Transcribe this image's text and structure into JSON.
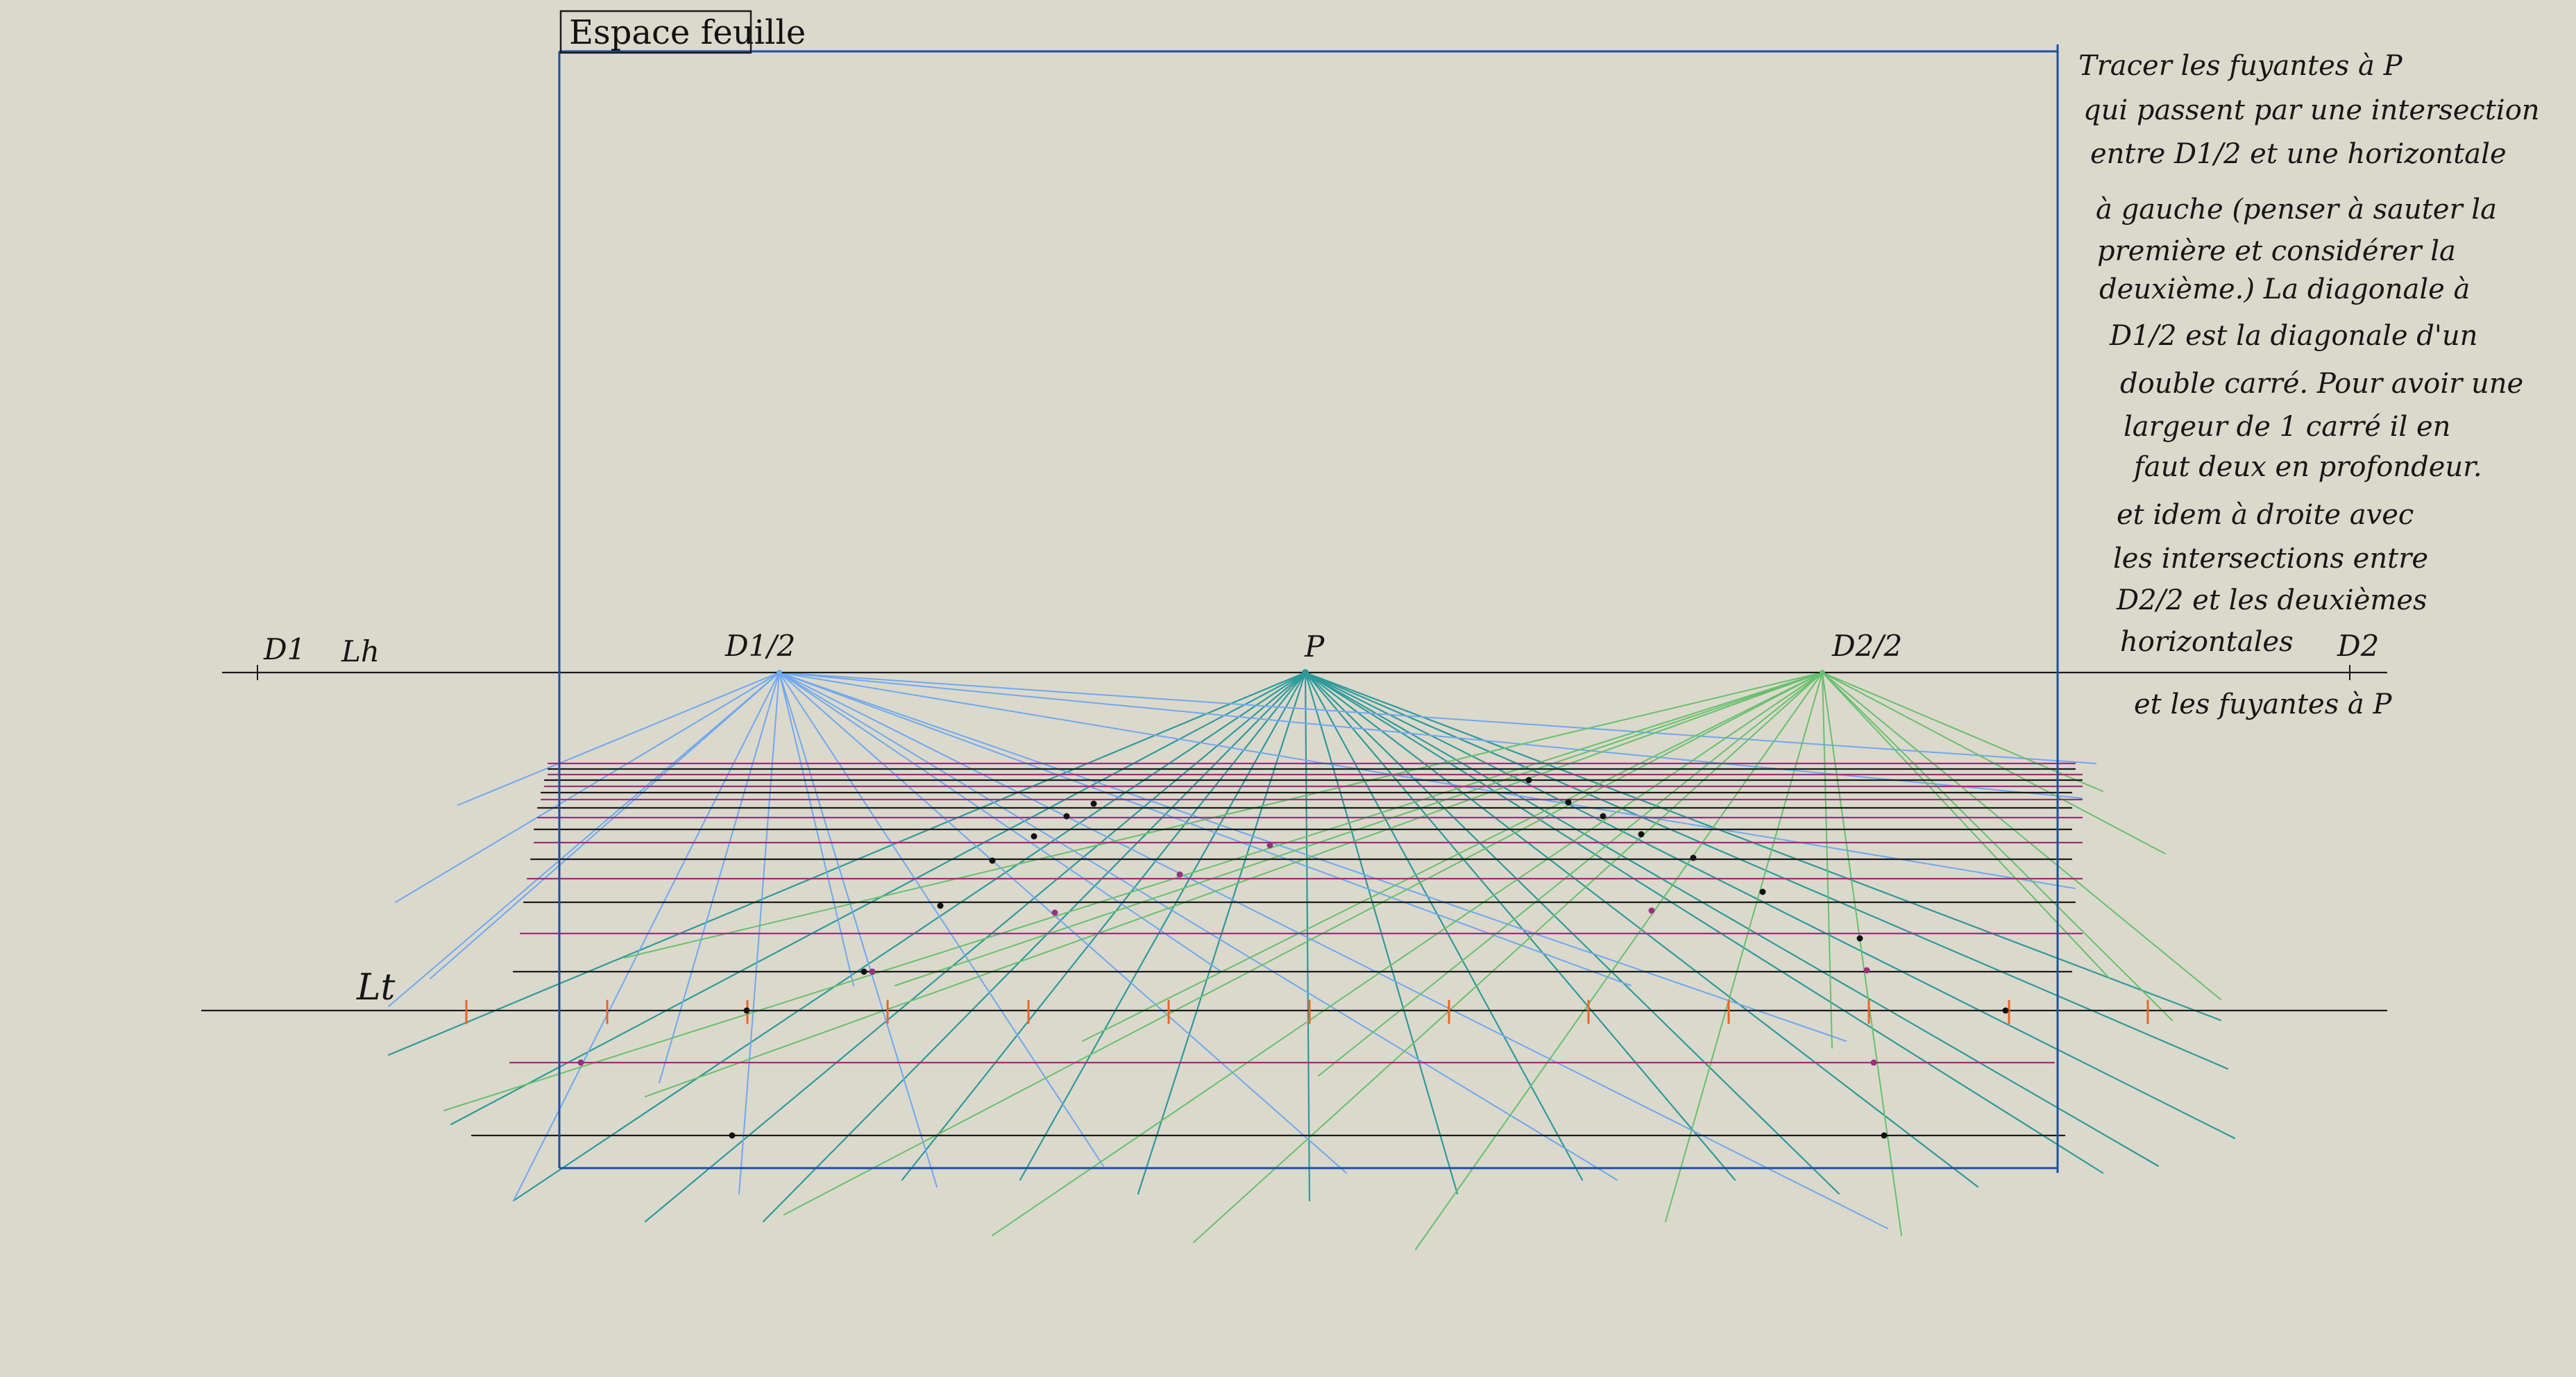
{
  "sheet": {
    "title": "Espace feuille"
  },
  "labels": {
    "d1": "D1",
    "lh": "Lh",
    "d_half_left": "D1/2",
    "p": "P",
    "d_half_right": "D2/2",
    "d2": "D2",
    "lt": "Lt"
  },
  "note_lines": [
    "Tracer les fuyantes à P",
    "qui passent par une intersection",
    "entre D1/2 et une horizontale",
    "à gauche (penser à sauter la",
    "première et considérer la",
    "deuxième.) La diagonale à",
    "D1/2 est la diagonale d'un",
    "double carré. Pour avoir une",
    "largeur de 1 carré il en",
    "faut deux en profondeur.",
    "et idem à droite avec",
    "les intersections entre",
    "D2/2 et les deuxièmes",
    "horizontales",
    "et les fuyantes à P"
  ],
  "colors": {
    "background": "#dbd9cc",
    "sheet_frame": "#1d4fa3",
    "vanishing_p": "#2e9a9a",
    "vanishing_d_half_left": "#6fa8f0",
    "vanishing_d_half_right": "#67c06d",
    "horizontals_black": "#1b1b1b",
    "horizontals_purple": "#9b2f7e",
    "lt_ticks": "#e8642c"
  }
}
